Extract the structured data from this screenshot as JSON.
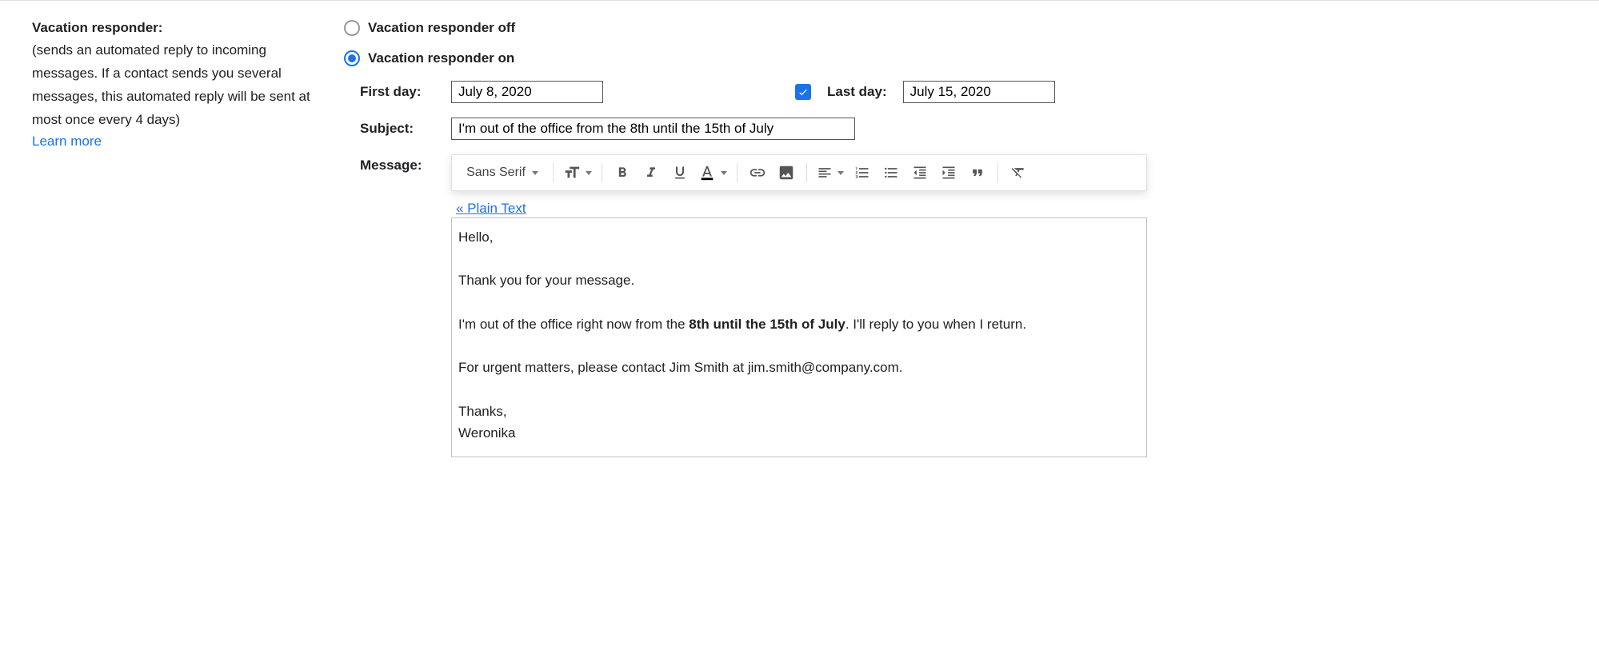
{
  "left": {
    "title": "Vacation responder:",
    "desc": "(sends an automated reply to incoming messages. If a contact sends you several messages, this automated reply will be sent at most once every 4 days)",
    "learn_more": "Learn more"
  },
  "radio": {
    "off_label": "Vacation responder off",
    "on_label": "Vacation responder on",
    "selected": "on"
  },
  "form": {
    "first_day_label": "First day:",
    "first_day_value": "July 8, 2020",
    "last_day_label": "Last day:",
    "last_day_value": "July 15, 2020",
    "last_day_checked": true,
    "subject_label": "Subject:",
    "subject_value": "I'm out of the office from the 8th until the 15th of July",
    "message_label": "Message:"
  },
  "toolbar": {
    "font": "Sans Serif",
    "items": [
      "font-size",
      "bold",
      "italic",
      "underline",
      "text-color",
      "link",
      "image",
      "align",
      "numbered-list",
      "bullet-list",
      "indent-less",
      "indent-more",
      "quote",
      "remove-formatting"
    ]
  },
  "plain_text_link": "« Plain Text",
  "message_body": {
    "line1": "Hello,",
    "line2": "Thank you for your message.",
    "line3a": "I'm out of the office right now from the ",
    "line3b": "8th until the 15th of July",
    "line3c": ". I'll reply to you when I return.",
    "line4": "For urgent matters, please contact Jim Smith at jim.smith@company.com.",
    "line5": "Thanks,",
    "line6": "Weronika"
  }
}
